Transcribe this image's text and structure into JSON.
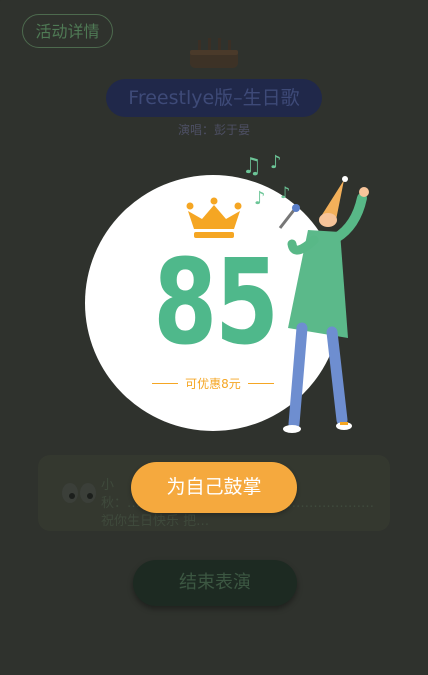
{
  "header": {
    "details_label": "活动详情",
    "song_title": "Freestlye版–生日歌",
    "singer_line": "演唱：彭于晏"
  },
  "comment": {
    "text": "小秋：…………………………………………………祝你生日快乐 把…"
  },
  "end_label": "结束表演",
  "result": {
    "score": "85",
    "discount": "可优惠8元",
    "applaud_label": "为自己鼓掌"
  },
  "colors": {
    "score_green": "#4fb88b",
    "accent_orange": "#f5a93e",
    "overlay_dark": "#2f322d"
  },
  "icons": [
    "crown-icon",
    "cake-icon",
    "music-note-icon",
    "eyes-icon",
    "singer-illustration"
  ]
}
